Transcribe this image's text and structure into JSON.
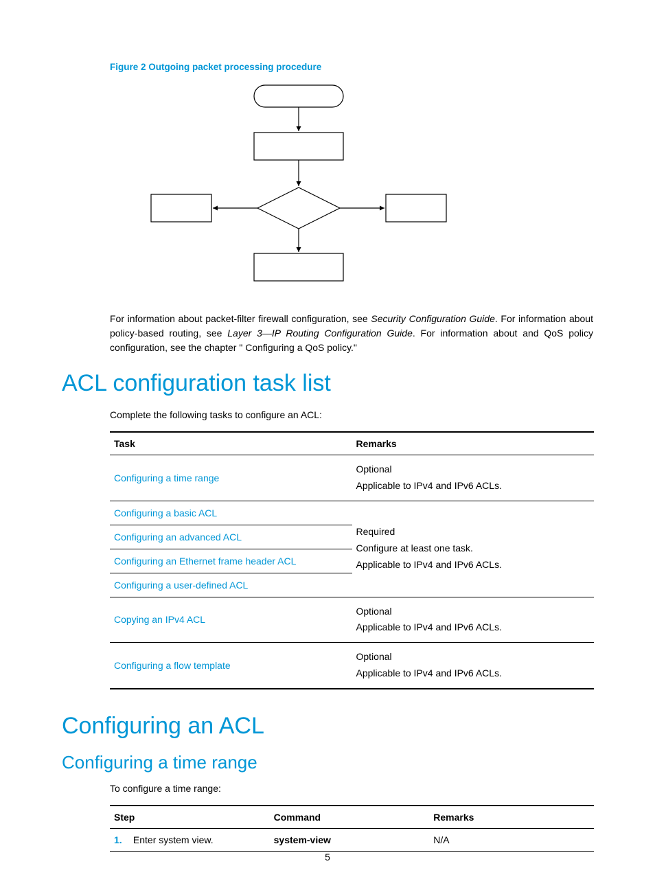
{
  "figure_caption": "Figure 2 Outgoing packet processing procedure",
  "body_para_1a": "For information about packet-filter firewall configuration, see ",
  "body_para_1b": "Security Configuration Guide",
  "body_para_1c": ". For information about policy-based routing, see ",
  "body_para_1d": "Layer 3—IP Routing Configuration Guide",
  "body_para_1e": ". For information about and QoS policy configuration, see the chapter \" Configuring a QoS policy.\"",
  "h1_task_list": "ACL configuration task list",
  "task_intro": "Complete the following tasks to configure an ACL:",
  "task_table": {
    "headers": {
      "task": "Task",
      "remarks": "Remarks"
    },
    "rows": {
      "r1": {
        "task": "Configuring a time range",
        "remarks_l1": "Optional",
        "remarks_l2": "Applicable to IPv4 and IPv6 ACLs."
      },
      "r2": {
        "task": "Configuring a basic ACL"
      },
      "r3": {
        "task": "Configuring an advanced ACL"
      },
      "r4": {
        "task": "Configuring an Ethernet frame header ACL"
      },
      "r5": {
        "task": "Configuring a user-defined ACL"
      },
      "group_remarks": {
        "l1": "Required",
        "l2": "Configure at least one task.",
        "l3": "Applicable to IPv4 and IPv6 ACLs."
      },
      "r6": {
        "task": "Copying an IPv4 ACL",
        "remarks_l1": "Optional",
        "remarks_l2": "Applicable to IPv4 and IPv6 ACLs."
      },
      "r7": {
        "task": "Configuring a flow template",
        "remarks_l1": "Optional",
        "remarks_l2": "Applicable to IPv4 and IPv6 ACLs."
      }
    }
  },
  "h1_configuring": "Configuring an ACL",
  "h2_time_range": "Configuring a time range",
  "time_range_intro": "To configure a time range:",
  "step_table": {
    "headers": {
      "step": "Step",
      "command": "Command",
      "remarks": "Remarks"
    },
    "rows": {
      "r1": {
        "num": "1.",
        "step": "Enter system view.",
        "command": "system-view",
        "remarks": "N/A"
      }
    }
  },
  "page_number": "5"
}
